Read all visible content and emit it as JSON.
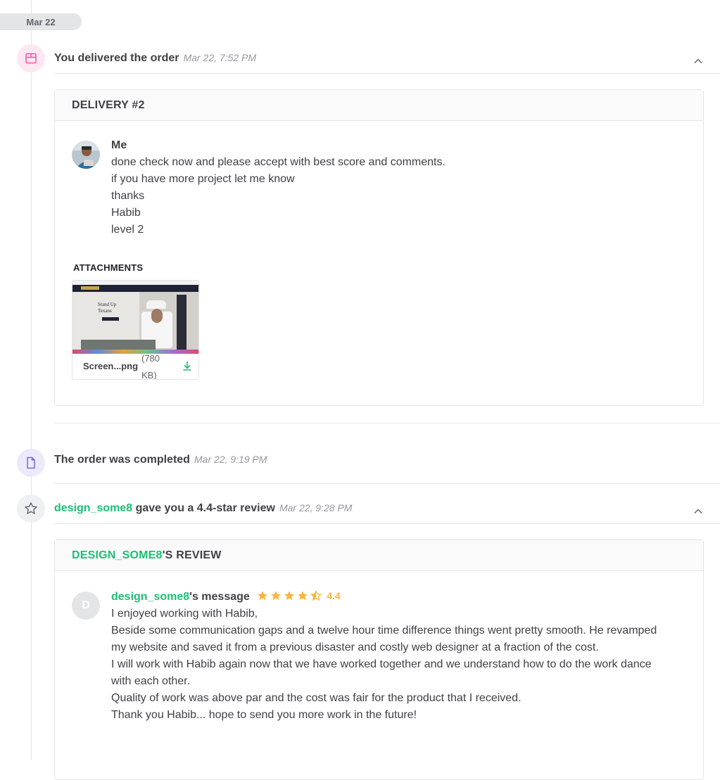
{
  "date_pill": "Mar 22",
  "events": {
    "delivered": {
      "title": "You delivered the order",
      "time": "Mar 22, 7:52 PM"
    },
    "completed": {
      "title": "The order was completed",
      "time": "Mar 22, 9:19 PM"
    },
    "review": {
      "user": "design_some8",
      "title_rest": " gave you a 4.4-star review",
      "time": "Mar 22, 9:28 PM"
    }
  },
  "delivery": {
    "header": "DELIVERY #2",
    "sender": "Me",
    "lines": [
      "done check now and please accept with best score and comments.",
      "if you have more project let me know",
      "thanks",
      "Habib",
      "level 2"
    ],
    "attachments_label": "ATTACHMENTS",
    "file": {
      "name": "Screen...png",
      "size": "(780 KB)",
      "thumb_heading": "Stand Up Texans"
    }
  },
  "review": {
    "header_user": "DESIGN_SOME8",
    "header_rest": "'S REVIEW",
    "avatar_letter": "D",
    "message_user": "design_some8",
    "message_rest": "'s message",
    "rating": 4.4,
    "rating_text": "4.4",
    "paragraphs": [
      "I enjoyed working with Habib,",
      "Beside some communication gaps and a twelve hour time difference things went pretty smooth. He revamped my website and saved it from a previous disaster and costly web designer at a fraction of the cost.",
      "I will work with Habib again now that we have worked together and we understand how to do the work dance with each other.",
      "Quality of work was above par and the cost was fair for the product that I received.",
      "Thank you Habib... hope to send you more work in the future!"
    ]
  },
  "colors": {
    "accent_green": "#1dbf73",
    "star": "#ffb33e",
    "delivered_icon_bg": "#fde7f2",
    "delivered_icon": "#e65ba4",
    "completed_icon_bg": "#ece9fb",
    "completed_icon": "#7b68d9",
    "review_icon_bg": "#eef0f3"
  },
  "icons": {
    "delivered": "package-icon",
    "completed": "document-icon",
    "review": "star-icon",
    "collapse": "chevron-up-icon",
    "download": "download-icon"
  }
}
